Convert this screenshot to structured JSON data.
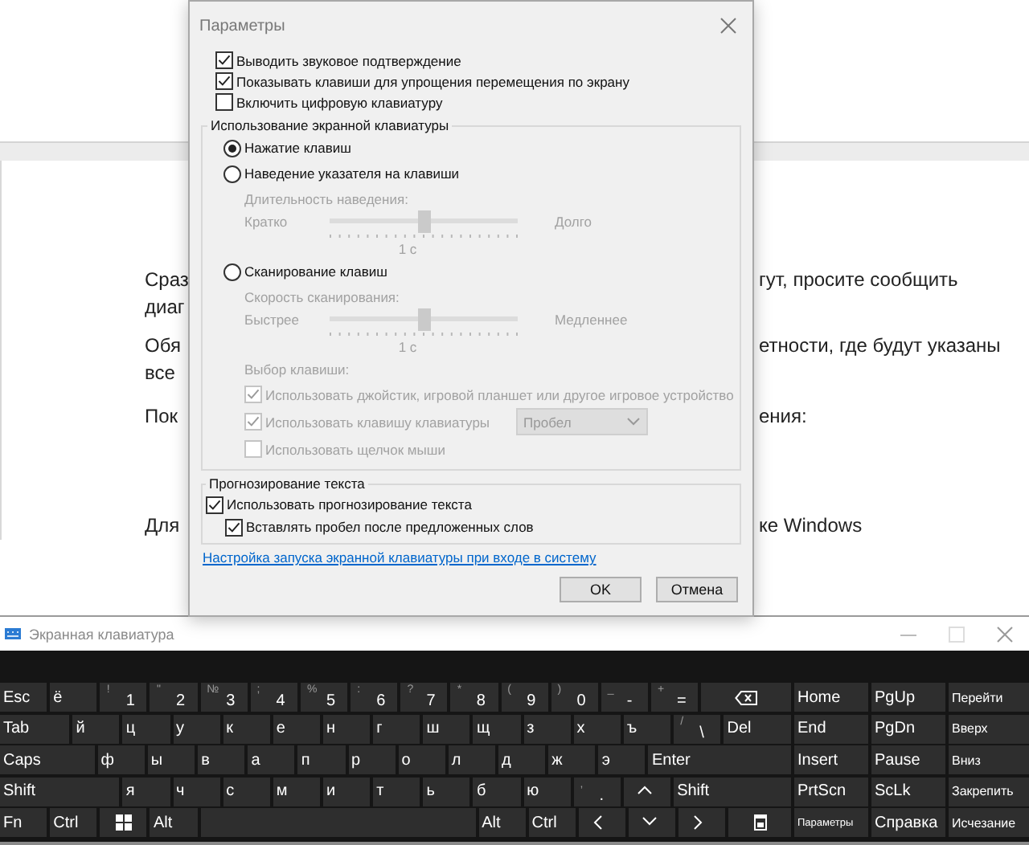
{
  "document": {
    "paragraphs": [
      {
        "lines": [
          {
            "left": "Сраз",
            "right": "гут, просите сообщить"
          },
          {
            "left": "диаг"
          }
        ]
      },
      {
        "lines": [
          {
            "left": "Обя",
            "right": "етности, где будут указаны"
          },
          {
            "left": "все"
          }
        ]
      },
      {
        "lines": [
          {
            "left": "Пок",
            "right": "ения:"
          }
        ]
      },
      {
        "lines": [
          {
            "left": "Для",
            "right": "ке Windows"
          }
        ]
      }
    ]
  },
  "settings_dialog": {
    "title": "Параметры",
    "options": [
      {
        "label": "Выводить звуковое подтверждение",
        "checked": true
      },
      {
        "label": "Показывать клавиши для упрощения перемещения по экрану",
        "checked": true
      },
      {
        "label": "Включить цифровую клавиатуру",
        "checked": false
      }
    ],
    "usage_group": {
      "title": "Использование экранной клавиатуры",
      "items": [
        {
          "kind": "radio",
          "label": "Нажатие клавиш",
          "selected": true,
          "disabled": false
        },
        {
          "kind": "radio",
          "label": "Наведение указателя на клавиши",
          "selected": false,
          "disabled": false
        },
        {
          "kind": "caption",
          "label": "Длительность наведения:",
          "disabled": true
        },
        {
          "kind": "slider",
          "min_label": "Кратко",
          "max_label": "Долго",
          "level": 0.5,
          "reading": "1 с",
          "disabled": true
        },
        {
          "kind": "radio",
          "label": "Сканирование клавиш",
          "selected": false,
          "disabled": false
        },
        {
          "kind": "caption",
          "label": "Скорость сканирования:",
          "disabled": true
        },
        {
          "kind": "slider",
          "min_label": "Быстрее",
          "max_label": "Медленнее",
          "level": 0.5,
          "reading": "1 с",
          "disabled": true
        },
        {
          "kind": "caption",
          "label": "Выбор клавиши:",
          "disabled": true
        },
        {
          "kind": "checkbox",
          "label": "Использовать джойстик, игровой планшет или другое игровое устройство",
          "checked": true,
          "disabled": true
        },
        {
          "kind": "checkbox",
          "label": "Использовать клавишу клавиатуры",
          "checked": true,
          "disabled": true,
          "dropdown": "Пробел"
        },
        {
          "kind": "checkbox",
          "label": "Использовать щелчок мыши",
          "checked": false,
          "disabled": true
        }
      ]
    },
    "prediction_group": {
      "title": "Прогнозирование текста",
      "items": [
        {
          "label": "Использовать прогнозирование текста",
          "checked": true,
          "children": [
            {
              "label": "Вставлять пробел после предложенных слов",
              "checked": true
            }
          ]
        }
      ]
    },
    "link": "Настройка запуска экранной клавиатуры при входе в систему",
    "buttons": [
      "OK",
      "Отмена"
    ]
  },
  "keyboard": {
    "title": "Экранная клавиатура",
    "main_rows": [
      [
        {
          "kind": "text",
          "label": "Esc"
        },
        {
          "kind": "text",
          "label": "ё"
        },
        {
          "kind": "text",
          "shift": "!",
          "label": "1"
        },
        {
          "kind": "text",
          "shift": "\"",
          "label": "2"
        },
        {
          "kind": "text",
          "shift": "№",
          "label": "3"
        },
        {
          "kind": "text",
          "shift": ";",
          "label": "4"
        },
        {
          "kind": "text",
          "shift": "%",
          "label": "5"
        },
        {
          "kind": "text",
          "shift": ":",
          "label": "6"
        },
        {
          "kind": "text",
          "shift": "?",
          "label": "7"
        },
        {
          "kind": "text",
          "shift": "*",
          "label": "8"
        },
        {
          "kind": "text",
          "shift": "(",
          "label": "9"
        },
        {
          "kind": "text",
          "shift": ")",
          "label": "0"
        },
        {
          "kind": "text",
          "shift": "_",
          "label": "-"
        },
        {
          "kind": "text",
          "shift": "+",
          "label": "="
        },
        {
          "kind": "backspace"
        }
      ],
      [
        {
          "kind": "text",
          "label": "Tab"
        },
        {
          "kind": "text",
          "label": "й"
        },
        {
          "kind": "text",
          "label": "ц"
        },
        {
          "kind": "text",
          "label": "у"
        },
        {
          "kind": "text",
          "label": "к"
        },
        {
          "kind": "text",
          "label": "е"
        },
        {
          "kind": "text",
          "label": "н"
        },
        {
          "kind": "text",
          "label": "г"
        },
        {
          "kind": "text",
          "label": "ш"
        },
        {
          "kind": "text",
          "label": "щ"
        },
        {
          "kind": "text",
          "label": "з"
        },
        {
          "kind": "text",
          "label": "х"
        },
        {
          "kind": "text",
          "label": "ъ"
        },
        {
          "kind": "text",
          "shift": "/",
          "label": "\\"
        },
        {
          "kind": "text",
          "label": "Del"
        }
      ],
      [
        {
          "kind": "text",
          "label": "Caps"
        },
        {
          "kind": "text",
          "label": "ф"
        },
        {
          "kind": "text",
          "label": "ы"
        },
        {
          "kind": "text",
          "label": "в"
        },
        {
          "kind": "text",
          "label": "а"
        },
        {
          "kind": "text",
          "label": "п"
        },
        {
          "kind": "text",
          "label": "р"
        },
        {
          "kind": "text",
          "label": "о"
        },
        {
          "kind": "text",
          "label": "л"
        },
        {
          "kind": "text",
          "label": "д"
        },
        {
          "kind": "text",
          "label": "ж"
        },
        {
          "kind": "text",
          "label": "э"
        },
        {
          "kind": "text",
          "label": "Enter"
        }
      ],
      [
        {
          "kind": "text",
          "label": "Shift"
        },
        {
          "kind": "text",
          "label": "я"
        },
        {
          "kind": "text",
          "label": "ч"
        },
        {
          "kind": "text",
          "label": "с"
        },
        {
          "kind": "text",
          "label": "м"
        },
        {
          "kind": "text",
          "label": "и"
        },
        {
          "kind": "text",
          "label": "т"
        },
        {
          "kind": "text",
          "label": "ь"
        },
        {
          "kind": "text",
          "label": "б"
        },
        {
          "kind": "text",
          "label": "ю"
        },
        {
          "kind": "text",
          "shift": ",",
          "label": "."
        },
        {
          "kind": "up"
        },
        {
          "kind": "text",
          "label": "Shift"
        }
      ],
      [
        {
          "kind": "text",
          "label": "Fn"
        },
        {
          "kind": "text",
          "label": "Ctrl"
        },
        {
          "kind": "windows"
        },
        {
          "kind": "text",
          "label": "Alt"
        },
        {
          "kind": "space"
        },
        {
          "kind": "text",
          "label": "Alt"
        },
        {
          "kind": "text",
          "label": "Ctrl"
        },
        {
          "kind": "left"
        },
        {
          "kind": "down"
        },
        {
          "kind": "right"
        },
        {
          "kind": "menu"
        }
      ]
    ],
    "nav_rows": [
      [
        "Home",
        "PgUp",
        "Перейти"
      ],
      [
        "End",
        "PgDn",
        "Вверх"
      ],
      [
        "Insert",
        "Pause",
        "Вниз"
      ],
      [
        "PrtScn",
        "ScLk",
        "Закрепить"
      ],
      [
        "Параметры",
        "Справка",
        "Исчезание"
      ]
    ]
  }
}
